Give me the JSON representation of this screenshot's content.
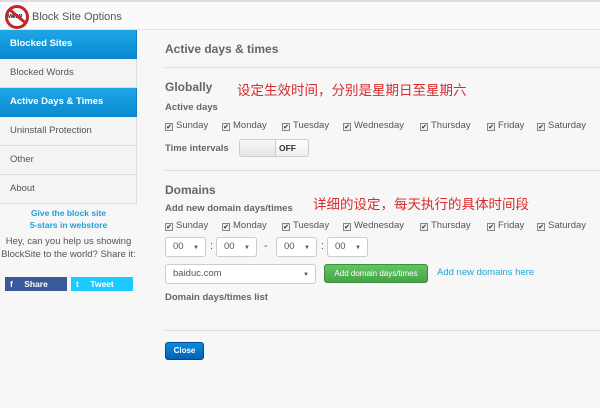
{
  "app": {
    "title": "Block Site Options",
    "logo_text": "www"
  },
  "sidebar": {
    "items": [
      {
        "label": "Blocked Sites",
        "active": true
      },
      {
        "label": "Blocked Words",
        "active": false
      },
      {
        "label": "Active Days & Times",
        "active": true
      },
      {
        "label": "Uninstall Protection",
        "active": false
      },
      {
        "label": "Other",
        "active": false
      },
      {
        "label": "About",
        "active": false
      }
    ],
    "promo_line1": "Give the block site",
    "promo_line2": "5-stars in webstore",
    "promo_text": "Hey, can you help us showing BlockSite to the world? Share it:",
    "share_label": "Share",
    "tweet_label": "Tweet"
  },
  "main": {
    "title": "Active days & times",
    "globally": {
      "heading": "Globally",
      "note": "设定生效时间，分别是星期日至星期六",
      "active_days_label": "Active days",
      "days": [
        {
          "label": "Sunday",
          "checked": true
        },
        {
          "label": "Monday",
          "checked": true
        },
        {
          "label": "Tuesday",
          "checked": true
        },
        {
          "label": "Wednesday",
          "checked": true
        },
        {
          "label": "Thursday",
          "checked": true
        },
        {
          "label": "Friday",
          "checked": true
        },
        {
          "label": "Saturday",
          "checked": true
        }
      ],
      "time_intervals_label": "Time intervals",
      "toggle_state": "OFF"
    },
    "domains": {
      "heading": "Domains",
      "note": "详细的设定，每天执行的具体时间段",
      "add_label": "Add new domain days/times",
      "days": [
        {
          "label": "Sunday",
          "checked": true
        },
        {
          "label": "Monday",
          "checked": true
        },
        {
          "label": "Tuesday",
          "checked": true
        },
        {
          "label": "Wednesday",
          "checked": true
        },
        {
          "label": "Thursday",
          "checked": true
        },
        {
          "label": "Friday",
          "checked": true
        },
        {
          "label": "Saturday",
          "checked": true
        }
      ],
      "time_from_hour": "00",
      "time_from_min": "00",
      "time_to_hour": "00",
      "time_to_min": "00",
      "colon": ":",
      "dash": "-",
      "domain_select": "baiduc.com",
      "add_button": "Add domain days/times",
      "add_link": "Add new domains here",
      "list_label": "Domain days/times list"
    },
    "close_button": "Close"
  },
  "colors": {
    "accent": "#0a8bd1",
    "note": "#d92b2b",
    "green": "#46a546",
    "facebook": "#3b5998",
    "twitter": "#1dcaff"
  }
}
